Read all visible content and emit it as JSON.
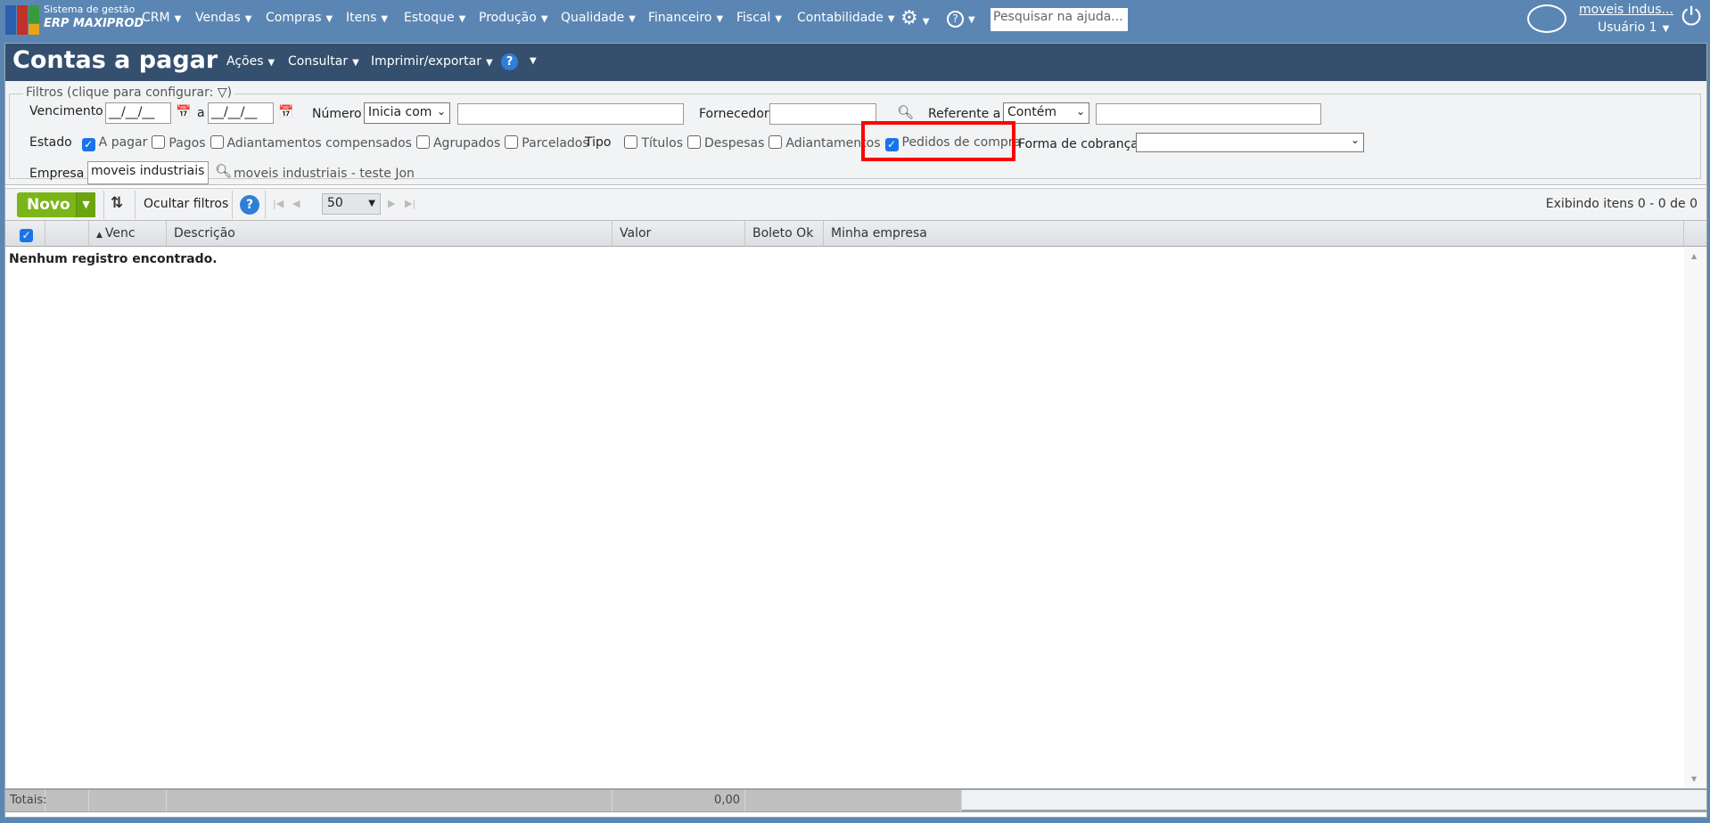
{
  "topbar": {
    "logo_line1": "Sistema de gestão",
    "logo_line2": "ERP MAXIPROD",
    "menu": [
      "CRM",
      "Vendas",
      "Compras",
      "Itens",
      "Estoque",
      "Produção",
      "Qualidade",
      "Financeiro",
      "Fiscal",
      "Contabilidade"
    ],
    "search_placeholder": "Pesquisar na ajuda...",
    "company_link": "moveis indus...",
    "user": "Usuário 1"
  },
  "header": {
    "title": "Contas a pagar",
    "menu": [
      "Ações",
      "Consultar",
      "Imprimir/exportar"
    ]
  },
  "filters": {
    "legend": "Filtros (clique para configurar:",
    "legend_close": ")",
    "vencimento_label": "Vencimento",
    "date_from": "__/__/__",
    "between": "a",
    "date_to": "__/__/__",
    "numero_label": "Número",
    "numero_op": "Inicia com",
    "numero_value": "",
    "fornecedor_label": "Fornecedor",
    "fornecedor_value": "",
    "referente_label": "Referente a",
    "referente_op": "Contém",
    "referente_value": "",
    "estado_label": "Estado",
    "estado": [
      {
        "label": "A pagar",
        "checked": true
      },
      {
        "label": "Pagos",
        "checked": false
      },
      {
        "label": "Adiantamentos compensados",
        "checked": false
      },
      {
        "label": "Agrupados",
        "checked": false
      },
      {
        "label": "Parcelados",
        "checked": false
      }
    ],
    "tipo_label": "Tipo",
    "tipo": [
      {
        "label": "Títulos",
        "checked": false
      },
      {
        "label": "Despesas",
        "checked": false
      },
      {
        "label": "Adiantamentos",
        "checked": false
      },
      {
        "label": "Pedidos de compra",
        "checked": true
      }
    ],
    "forma_label": "Forma de cobrança",
    "forma_value": "",
    "empresa_label": "Empresa",
    "empresa_value": "moveis industriais -",
    "empresa_desc": "moveis industriais - teste Jon"
  },
  "toolbar": {
    "novo": "Novo",
    "ocultar": "Ocultar filtros",
    "page_size": "50",
    "status": "Exibindo itens 0 - 0 de 0"
  },
  "table": {
    "columns": [
      "",
      "",
      "Venc",
      "Descrição",
      "Valor",
      "Boleto Ok",
      "Minha empresa"
    ],
    "empty": "Nenhum registro encontrado."
  },
  "totals": {
    "label": "Totais:",
    "valor": "0,00"
  },
  "colors": {
    "topbar": "#5b86b4",
    "header": "#34506e",
    "novo": "#7cb518",
    "highlight": "#ff0000"
  }
}
